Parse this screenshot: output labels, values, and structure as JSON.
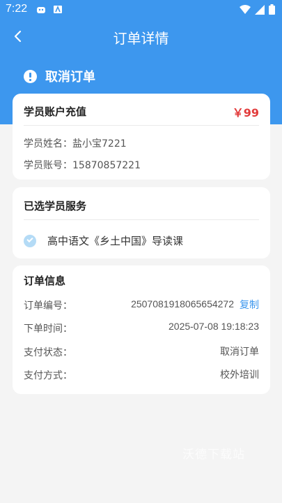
{
  "status_bar": {
    "time": "7:22"
  },
  "header": {
    "title": "订单详情"
  },
  "order_status": {
    "label": "取消订单"
  },
  "account_card": {
    "title": "学员账户充值",
    "price": "￥99",
    "student_name": "学员姓名：盐小宝7221",
    "student_account": "学员账号：15870857221"
  },
  "service_card": {
    "title": "已选学员服务",
    "item": "高中语文《乡土中国》导读课"
  },
  "order_info": {
    "title": "订单信息",
    "rows": [
      {
        "label": "订单编号：",
        "value": "2507081918065654272"
      },
      {
        "label": "下单时间：",
        "value": "2025-07-08 19:18:23"
      },
      {
        "label": "支付状态：",
        "value": "取消订单"
      },
      {
        "label": "支付方式：",
        "value": "校外培训"
      }
    ],
    "copy_label": "复制"
  },
  "watermark": "沃德下载站",
  "colors": {
    "primary": "#3d97ee",
    "price": "#e23b3b",
    "background": "#f4f4f4"
  }
}
